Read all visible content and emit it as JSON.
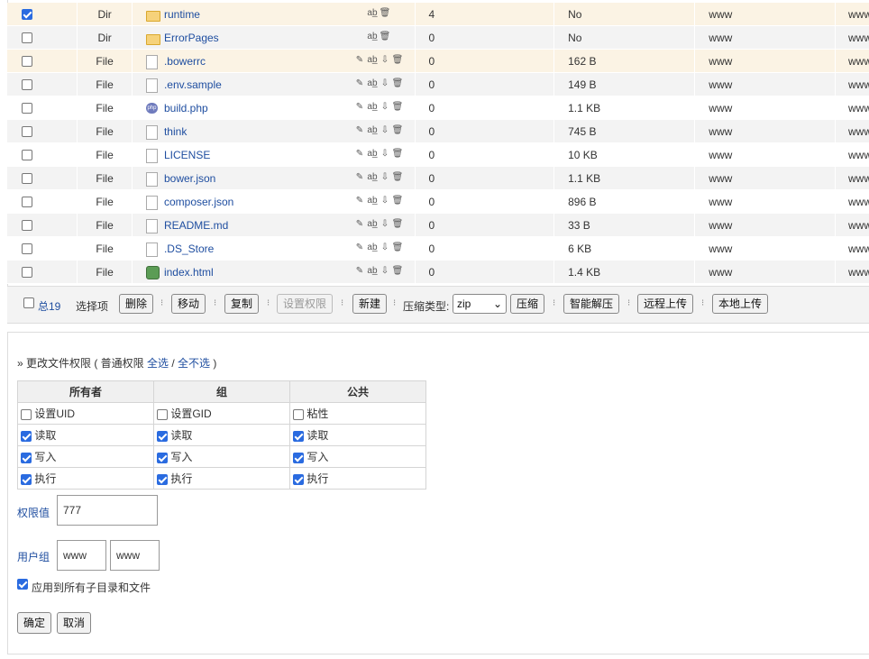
{
  "files": [
    {
      "checked": true,
      "type": "Dir",
      "icon": "folder-icon",
      "name": "runtime",
      "count": "4",
      "size": "No",
      "owner": "www",
      "group": "www",
      "highlight": true
    },
    {
      "checked": false,
      "type": "Dir",
      "icon": "folder-icon",
      "name": "ErrorPages",
      "count": "0",
      "size": "No",
      "owner": "www",
      "group": "www"
    },
    {
      "checked": false,
      "type": "File",
      "icon": "file-icon",
      "name": ".bowerrc",
      "count": "0",
      "size": "162 B",
      "owner": "www",
      "group": "www",
      "highlight": true
    },
    {
      "checked": false,
      "type": "File",
      "icon": "file-icon",
      "name": ".env.sample",
      "count": "0",
      "size": "149 B",
      "owner": "www",
      "group": "www"
    },
    {
      "checked": false,
      "type": "File",
      "icon": "php-file-icon",
      "name": "build.php",
      "count": "0",
      "size": "1.1 KB",
      "owner": "www",
      "group": "www"
    },
    {
      "checked": false,
      "type": "File",
      "icon": "file-icon",
      "name": "think",
      "count": "0",
      "size": "745 B",
      "owner": "www",
      "group": "www"
    },
    {
      "checked": false,
      "type": "File",
      "icon": "file-icon",
      "name": "LICENSE",
      "count": "0",
      "size": "10 KB",
      "owner": "www",
      "group": "www"
    },
    {
      "checked": false,
      "type": "File",
      "icon": "file-icon",
      "name": "bower.json",
      "count": "0",
      "size": "1.1 KB",
      "owner": "www",
      "group": "www"
    },
    {
      "checked": false,
      "type": "File",
      "icon": "file-icon",
      "name": "composer.json",
      "count": "0",
      "size": "896 B",
      "owner": "www",
      "group": "www"
    },
    {
      "checked": false,
      "type": "File",
      "icon": "file-icon",
      "name": "README.md",
      "count": "0",
      "size": "33 B",
      "owner": "www",
      "group": "www"
    },
    {
      "checked": false,
      "type": "File",
      "icon": "file-icon",
      "name": ".DS_Store",
      "count": "0",
      "size": "6 KB",
      "owner": "www",
      "group": "www"
    },
    {
      "checked": false,
      "type": "File",
      "icon": "html-file-icon",
      "name": "index.html",
      "count": "0",
      "size": "1.4 KB",
      "owner": "www",
      "group": "www"
    }
  ],
  "toolbar": {
    "total_label": "总19",
    "selected_label": "选择项",
    "delete": "删除",
    "move": "移动",
    "copy": "复制",
    "set_perm": "设置权限",
    "new": "新建",
    "compress_type_label": "压缩类型:",
    "compress_type_value": "zip",
    "compress": "压缩",
    "smart_extract": "智能解压",
    "remote_upload": "远程上传",
    "local_upload": "本地上传"
  },
  "perm": {
    "title_prefix": "» 更改文件权限 ( 普通权限 ",
    "select_all": "全选",
    "slash": " / ",
    "select_none": "全不选",
    "title_suffix": " )",
    "headers": [
      "所有者",
      "组",
      "公共"
    ],
    "special": [
      "设置UID",
      "设置GID",
      "粘性"
    ],
    "read": "读取",
    "write": "写入",
    "exec": "执行",
    "value_label": "权限值",
    "value": "777",
    "usergroup_label": "用户组",
    "user": "www",
    "group": "www",
    "apply_recursive": "应用到所有子目录和文件",
    "ok": "确定",
    "cancel": "取消"
  }
}
